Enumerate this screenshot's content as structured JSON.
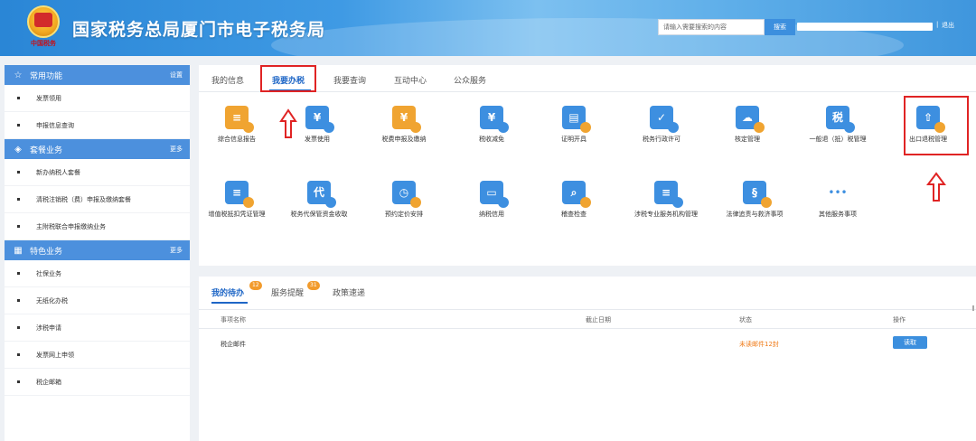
{
  "header": {
    "title": "国家税务总局厦门市电子税务局",
    "emblem_text": "中国税务",
    "search_placeholder": "请输入需要搜索的内容",
    "search_button": "搜索",
    "separator": "|",
    "logout": "退出"
  },
  "sidebar": {
    "sections": [
      {
        "title": "常用功能",
        "action": "设置",
        "icon": "star-icon",
        "items": [
          "发票领用",
          "申报信息查询"
        ]
      },
      {
        "title": "套餐业务",
        "action": "更多",
        "icon": "layers-icon",
        "items": [
          "新办纳税人套餐",
          "清税注销税（费）申报及缴纳套餐",
          "主附税联合申报缴纳业务"
        ]
      },
      {
        "title": "特色业务",
        "action": "更多",
        "icon": "grid-icon",
        "items": [
          "社保业务",
          "无纸化办税",
          "涉税申请",
          "发票网上申领",
          "税企邮箱"
        ]
      }
    ]
  },
  "tabs": [
    "我的信息",
    "我要办税",
    "我要查询",
    "互动中心",
    "公众服务"
  ],
  "active_tab": "我要办税",
  "services_row1": [
    {
      "label": "综合信息报告",
      "icon": "document-icon",
      "color": "#f0a431"
    },
    {
      "label": "发票使用",
      "icon": "invoice-yen-icon",
      "color": "#3d8fe0"
    },
    {
      "label": "税费申报及缴纳",
      "icon": "yen-coin-icon",
      "color": "#f0a431"
    },
    {
      "label": "税收减免",
      "icon": "tax-reduction-icon",
      "color": "#3d8fe0"
    },
    {
      "label": "证明开具",
      "icon": "certificate-icon",
      "color": "#3d8fe0"
    },
    {
      "label": "税务行政许可",
      "icon": "briefcase-check-icon",
      "color": "#3d8fe0"
    },
    {
      "label": "核定管理",
      "icon": "folder-cloud-icon",
      "color": "#3d8fe0"
    },
    {
      "label": "一般退（抵）税管理",
      "icon": "tax-refund-icon",
      "color": "#3d8fe0"
    },
    {
      "label": "出口退税管理",
      "icon": "export-tray-icon",
      "color": "#3d8fe0"
    }
  ],
  "services_row2": [
    {
      "label": "增值税抵扣凭证管理",
      "icon": "voucher-person-icon",
      "color": "#3d8fe0"
    },
    {
      "label": "税务代保管资金收取",
      "icon": "agent-fund-icon",
      "color": "#3d8fe0"
    },
    {
      "label": "预约定价安排",
      "icon": "calendar-clock-icon",
      "color": "#3d8fe0"
    },
    {
      "label": "纳税信用",
      "icon": "monitor-credit-icon",
      "color": "#3d8fe0"
    },
    {
      "label": "稽查检查",
      "icon": "doc-search-icon",
      "color": "#3d8fe0"
    },
    {
      "label": "涉税专业服务机构管理",
      "icon": "agency-doc-icon",
      "color": "#3d8fe0"
    },
    {
      "label": "法律追责与救济事项",
      "icon": "legal-doc-icon",
      "color": "#3d8fe0"
    },
    {
      "label": "其他服务事项",
      "icon": "more-dots-icon",
      "color": "#3d8fe0"
    }
  ],
  "bottom_tabs": [
    {
      "label": "我的待办",
      "count": "12"
    },
    {
      "label": "服务提醒",
      "count": "31"
    },
    {
      "label": "政策速递",
      "count": ""
    }
  ],
  "table": {
    "headers": [
      "事项名称",
      "截止日期",
      "状态",
      "操作"
    ],
    "rows": [
      {
        "name": "税企邮件",
        "deadline": "",
        "status": "未读邮件12封",
        "action": "读取"
      }
    ]
  },
  "colors": {
    "accent": "#1e66c6",
    "header_blue": "#3f96dd",
    "highlight_red": "#e02424",
    "status_orange": "#f07c1a"
  }
}
